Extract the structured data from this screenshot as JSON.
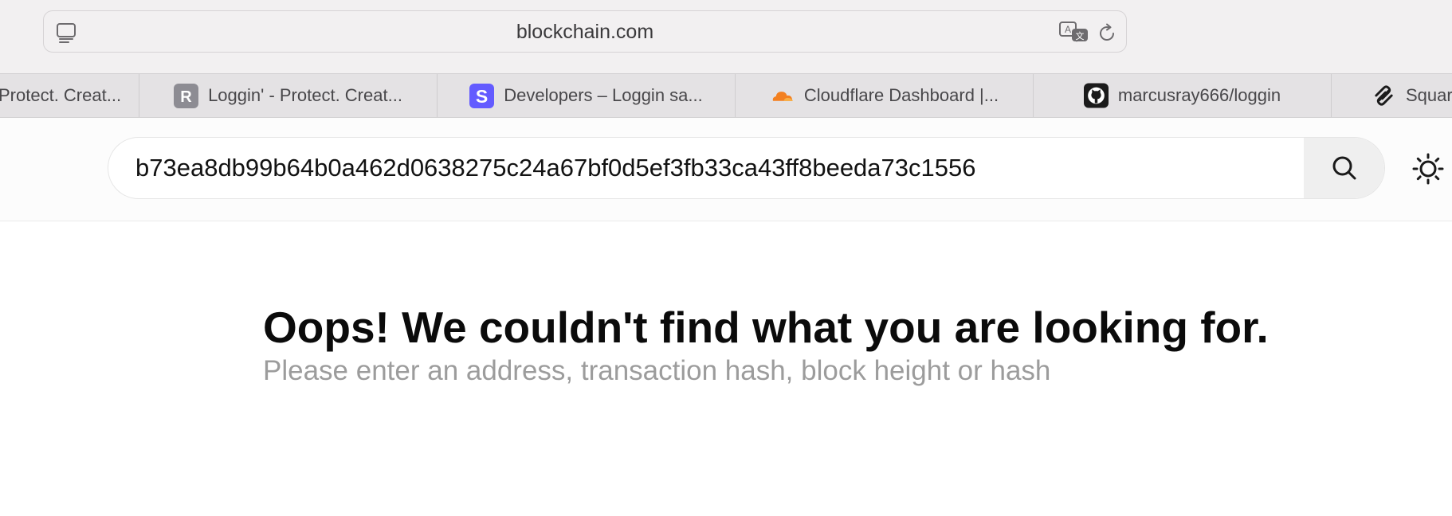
{
  "browser": {
    "url": "blockchain.com",
    "tabs": [
      {
        "title": "Protect. Creat...",
        "favicon": "none"
      },
      {
        "title": "Loggin' - Protect. Creat...",
        "favicon": "r-letter-icon"
      },
      {
        "title": "Developers – Loggin sa...",
        "favicon": "stripe-s-icon"
      },
      {
        "title": "Cloudflare Dashboard |...",
        "favicon": "cloudflare-cloud-icon"
      },
      {
        "title": "marcusray666/loggin",
        "favicon": "github-octocat-icon"
      },
      {
        "title": "Squar",
        "favicon": "squarespace-icon"
      }
    ]
  },
  "search": {
    "value": "b73ea8db99b64b0a462d0638275c24a67bf0d5ef3fb33ca43ff8beeda73c1556"
  },
  "error": {
    "title": "Oops! We couldn't find what you are looking for.",
    "subtitle": "Please enter an address, transaction hash, block height or hash"
  },
  "colors": {
    "toolbar_bg": "#f2f0f1",
    "tabbar_bg": "#e4e2e4",
    "stripe_brand": "#635bff",
    "cloudflare_brand": "#f38020",
    "spellcheck_underline": "#e0556a",
    "subtitle_text": "#9c9c9c"
  },
  "icons": [
    "sidebar-icon",
    "translate-icon",
    "reload-icon",
    "search-icon",
    "sun-icon"
  ]
}
